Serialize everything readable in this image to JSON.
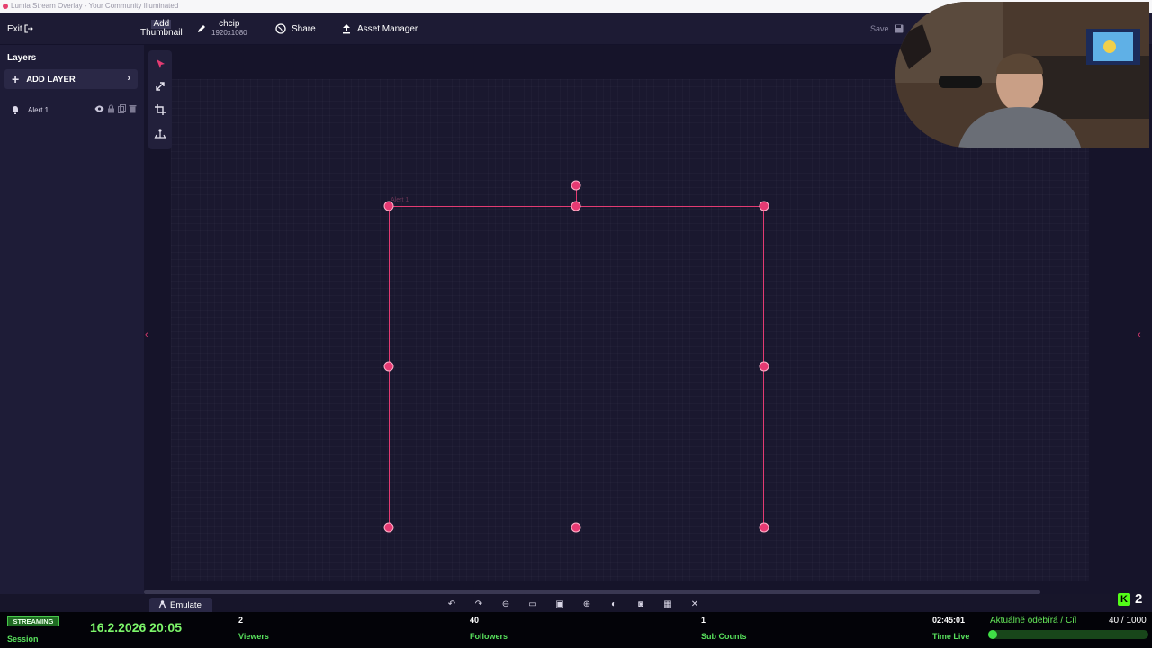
{
  "window": {
    "title": "Lumia Stream Overlay - Your Community Illuminated"
  },
  "toolbar": {
    "exit_label": "Exit",
    "thumbnail_label_1": "Add",
    "thumbnail_label_2": "Thumbnail",
    "project_name": "chcip",
    "project_resolution": "1920x1080",
    "share_label": "Share",
    "asset_manager_label": "Asset Manager",
    "save_label": "Save"
  },
  "layers": {
    "title": "Layers",
    "add_layer_label": "ADD LAYER",
    "items": [
      {
        "name": "Alert 1"
      }
    ]
  },
  "canvas": {
    "selected_layer_tag": "Alert 1",
    "emulate_label": "Emulate"
  },
  "stream_bar": {
    "status_badge": "STREAMING",
    "session_label": "Session",
    "datetime": "16.2.2026 20:05",
    "viewers_value": "2",
    "viewers_label": "Viewers",
    "followers_value": "40",
    "followers_label": "Followers",
    "subs_value": "1",
    "subs_label": "Sub Counts",
    "time_value": "02:45:01",
    "time_label": "Time Live",
    "goal_title": "Aktuálně odebírá / Cíl",
    "goal_count": "40 / 1000",
    "goal_progress": 0.04,
    "kick_count": "2",
    "kick_logo_letter": "K"
  },
  "colors": {
    "accent": "#e33b72",
    "panel": "#1e1c37",
    "canvas": "#16142a",
    "stream_green": "#58e05c"
  },
  "icons": [
    "pencil-icon",
    "globe-icon",
    "upload-icon",
    "save-icon",
    "pointer-icon",
    "resize-icon",
    "crop-icon",
    "anchor-icon",
    "eye-icon",
    "lock-icon",
    "copy-icon",
    "trash-icon",
    "plus-icon",
    "chevron-right-icon",
    "chevron-left-icon",
    "exit-icon",
    "alert-icon",
    "person-icon",
    "undo-icon",
    "redo-icon",
    "zoom-icon",
    "camera-icon",
    "grid-icon"
  ]
}
